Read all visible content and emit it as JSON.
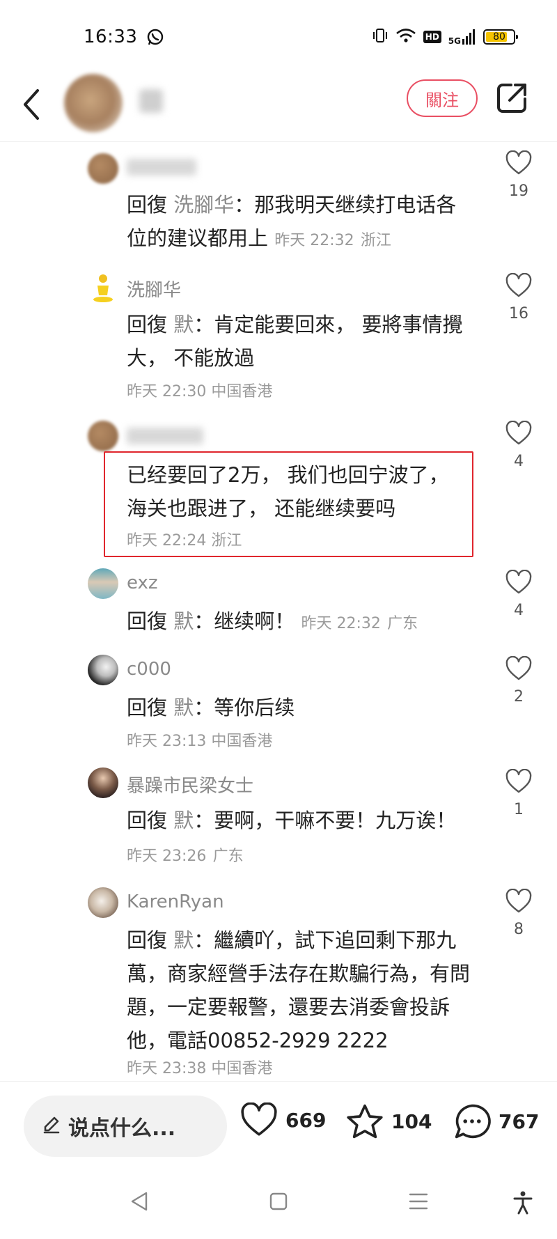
{
  "status_bar": {
    "time": "16:33",
    "battery": "80",
    "battery_level": 0.8,
    "icons": [
      "whatsapp-icon",
      "vibrate-icon",
      "wifi-icon",
      "hd-icon",
      "5g-signal-icon",
      "battery-icon"
    ],
    "hd_label": "HD",
    "network_label": "5G"
  },
  "header": {
    "follow_label": "關注",
    "icons": [
      "back-icon",
      "share-icon"
    ]
  },
  "comments": [
    {
      "reply_kw": "回復",
      "reply_to": "洗腳华",
      "text": "：那我明天继续打电话各位的建议都用上",
      "time": "昨天 22:32",
      "location": "浙江",
      "likes": "19"
    },
    {
      "name": "洗腳华",
      "reply_kw": "回復",
      "reply_to": "默",
      "text": "：肯定能要回來， 要將事情攪大， 不能放過",
      "time": "昨天 22:30",
      "location": "中国香港",
      "likes": "16"
    },
    {
      "text": "已经要回了2万， 我们也回宁波了， 海关也跟进了， 还能继续要吗",
      "time": "昨天 22:24",
      "location": "浙江",
      "likes": "4"
    },
    {
      "name": "exz",
      "reply_kw": "回復",
      "reply_to": "默",
      "text": "：继续啊！",
      "time": "昨天 22:32",
      "location": "广东",
      "likes": "4"
    },
    {
      "name": "c000",
      "reply_kw": "回復",
      "reply_to": "默",
      "text": "：等你后续",
      "time": "昨天 23:13",
      "location": "中国香港",
      "likes": "2"
    },
    {
      "name": "暴躁市民梁女士",
      "reply_kw": "回復",
      "reply_to": "默",
      "text": "：要啊，干嘛不要！九万诶！",
      "time": "昨天 23:26",
      "location": "广东",
      "likes": "1"
    },
    {
      "name": "KarenRyan",
      "reply_kw": "回復",
      "reply_to": "默",
      "text": "：繼續吖，試下追回剩下那九萬，商家經營手法存在欺騙行為，有問題，一定要報警，還要去消委會投訴他，電話00852-2929 2222",
      "time": "昨天 23:38",
      "location": "中国香港",
      "likes": "8"
    }
  ],
  "bottom_bar": {
    "input_placeholder": "说点什么...",
    "likes": "669",
    "favorites": "104",
    "comments": "767"
  },
  "colors": {
    "accent": "#e94f63",
    "highlight_border": "#e0262d",
    "muted_text": "#8a8a8a"
  }
}
